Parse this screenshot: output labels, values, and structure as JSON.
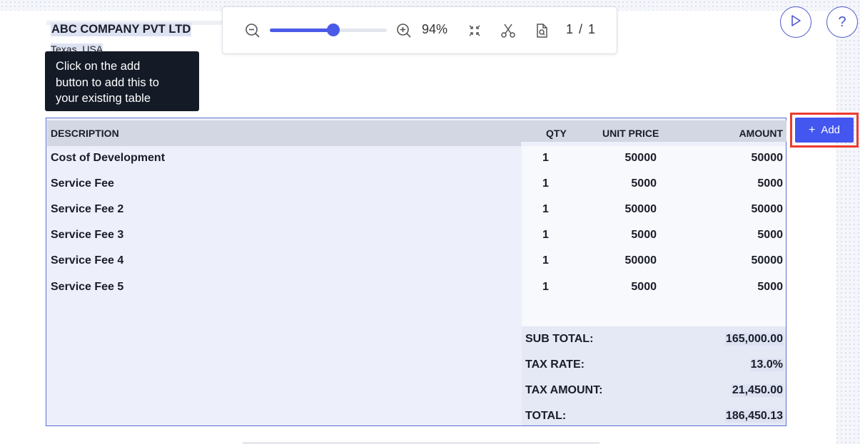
{
  "company": {
    "name": "ABC COMPANY PVT LTD",
    "address": "Texas, USA"
  },
  "tooltip": {
    "text": "Click on the add\nbutton to add this to\nyour existing table"
  },
  "toolbar": {
    "zoom_out_icon": "zoom-out-icon",
    "zoom_in_icon": "zoom-in-icon",
    "zoom_level": 0.54,
    "zoom_label": "94%",
    "collapse_icon": "collapse-icon",
    "scissors_icon": "scissors-icon",
    "page_icon": "page-search-icon",
    "page_indicator": "1 / 1"
  },
  "top_buttons": {
    "play_icon": "play-icon",
    "help_label": "?"
  },
  "table": {
    "headers": {
      "description": "DESCRIPTION",
      "qty": "QTY",
      "unit_price": "UNIT PRICE",
      "amount": "AMOUNT"
    },
    "rows": [
      {
        "description": "Cost of Development",
        "qty": "1",
        "unit_price": "50000",
        "amount": "50000"
      },
      {
        "description": "Service Fee",
        "qty": "1",
        "unit_price": "5000",
        "amount": "5000"
      },
      {
        "description": "Service Fee 2",
        "qty": "1",
        "unit_price": "50000",
        "amount": "50000"
      },
      {
        "description": "Service Fee 3",
        "qty": "1",
        "unit_price": "5000",
        "amount": "5000"
      },
      {
        "description": "Service Fee 4",
        "qty": "1",
        "unit_price": "50000",
        "amount": "50000"
      },
      {
        "description": "Service Fee 5",
        "qty": "1",
        "unit_price": "5000",
        "amount": "5000"
      }
    ],
    "summary": [
      {
        "label": "SUB TOTAL:",
        "value": "165,000.00"
      },
      {
        "label": "TAX RATE:",
        "value": "13.0%"
      },
      {
        "label": "TAX AMOUNT:",
        "value": "21,450.00"
      },
      {
        "label": "TOTAL:",
        "value": "186,450.13"
      }
    ]
  },
  "add_button": {
    "label": "Add",
    "icon": "plus-icon"
  },
  "colors": {
    "accent": "#4356f0",
    "highlight_border": "#ec3b2e",
    "table_border": "#5b6fd3"
  }
}
